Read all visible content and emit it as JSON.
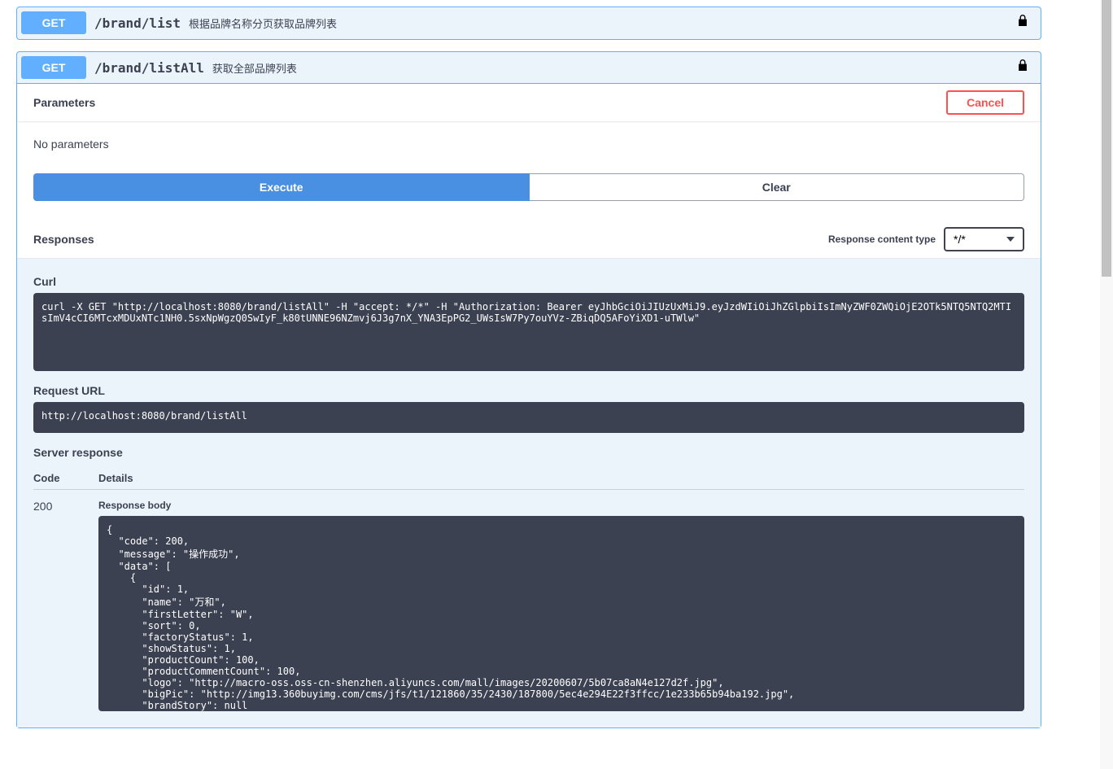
{
  "endpoints": [
    {
      "method": "GET",
      "path": "/brand/list",
      "description": "根据品牌名称分页获取品牌列表"
    },
    {
      "method": "GET",
      "path": "/brand/listAll",
      "description": "获取全部品牌列表"
    }
  ],
  "parameters": {
    "section_title": "Parameters",
    "cancel_label": "Cancel",
    "no_params_text": "No parameters",
    "execute_label": "Execute",
    "clear_label": "Clear"
  },
  "responses": {
    "section_title": "Responses",
    "content_type_label": "Response content type",
    "content_type_value": "*/*",
    "curl_label": "Curl",
    "curl_command": "curl -X GET \"http://localhost:8080/brand/listAll\" -H \"accept: */*\" -H \"Authorization: Bearer eyJhbGciOiJIUzUxMiJ9.eyJzdWIiOiJhZGlpbiIsImNyZWF0ZWQiOjE2OTk5NTQ5NTQ2MTIsImV4cCI6MTcxMDUxNTc1NH0.5sxNpWgzQ0SwIyF_k80tUNNE96NZmvj6J3g7nX_YNA3EpPG2_UWsIsW7Py7ouYVz-ZBiqDQ5AFoYiXD1-uTWlw\"",
    "url_label": "Request URL",
    "url_value": "http://localhost:8080/brand/listAll",
    "server_resp_label": "Server response",
    "col_code": "Code",
    "col_details": "Details",
    "code": "200",
    "body_label": "Response body",
    "body_json": "{\n  \"code\": 200,\n  \"message\": \"操作成功\",\n  \"data\": [\n    {\n      \"id\": 1,\n      \"name\": \"万和\",\n      \"firstLetter\": \"W\",\n      \"sort\": 0,\n      \"factoryStatus\": 1,\n      \"showStatus\": 1,\n      \"productCount\": 100,\n      \"productCommentCount\": 100,\n      \"logo\": \"http://macro-oss.oss-cn-shenzhen.aliyuncs.com/mall/images/20200607/5b07ca8aN4e127d2f.jpg\",\n      \"bigPic\": \"http://img13.360buyimg.com/cms/jfs/t1/121860/35/2430/187800/5ec4e294E22f3ffcc/1e233b65b94ba192.jpg\",\n      \"brandStory\": null\n    },\n    {"
  }
}
